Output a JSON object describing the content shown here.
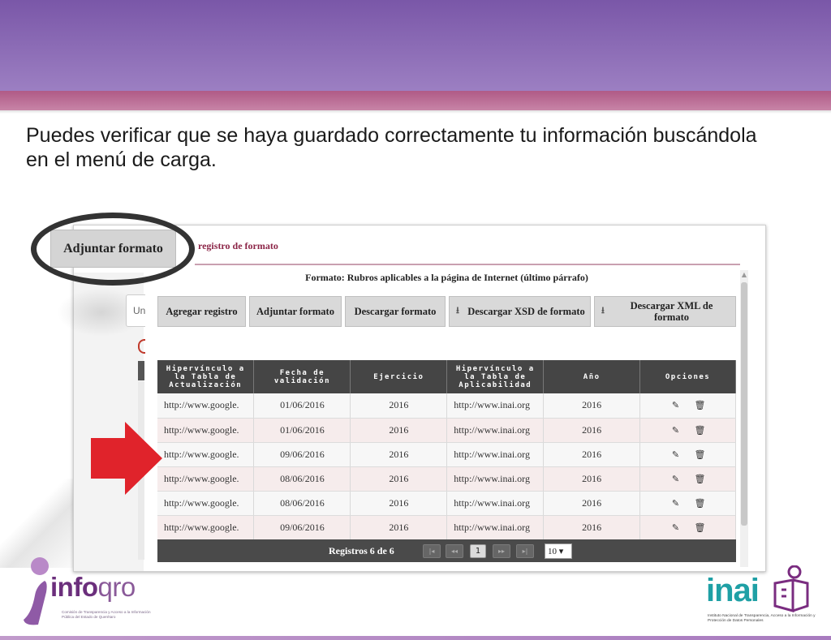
{
  "intro_text": "Puedes verificar que se haya guardado correctamente tu información buscándola en el menú de carga.",
  "modal": {
    "title": "registro de formato",
    "format_title": "Formato: Rubros aplicables a la página de Internet (último párrafo)"
  },
  "background": {
    "input_fragment": "Un"
  },
  "toolbar": {
    "agregar": "Agregar registro",
    "adjuntar": "Adjuntar formato",
    "descargar": "Descargar formato",
    "descargar_xsd": "Descargar XSD de formato",
    "descargar_xml": "Descargar XML de formato"
  },
  "callout": {
    "label": "Adjuntar formato"
  },
  "table": {
    "headers": [
      "Hipervínculo a la Tabla de Actualización",
      "Fecha de validación",
      "Ejercicio",
      "Hipervínculo a la Tabla de Aplicabilidad",
      "Año",
      "Opciones"
    ],
    "rows": [
      {
        "url1": "http://www.google.",
        "fecha": "01/06/2016",
        "ejercicio": "2016",
        "url2": "http://www.inai.org",
        "anio": "2016"
      },
      {
        "url1": "http://www.google.",
        "fecha": "01/06/2016",
        "ejercicio": "2016",
        "url2": "http://www.inai.org",
        "anio": "2016"
      },
      {
        "url1": "http://www.google.",
        "fecha": "09/06/2016",
        "ejercicio": "2016",
        "url2": "http://www.inai.org",
        "anio": "2016"
      },
      {
        "url1": "http://www.google.",
        "fecha": "08/06/2016",
        "ejercicio": "2016",
        "url2": "http://www.inai.org",
        "anio": "2016"
      },
      {
        "url1": "http://www.google.",
        "fecha": "08/06/2016",
        "ejercicio": "2016",
        "url2": "http://www.inai.org",
        "anio": "2016"
      },
      {
        "url1": "http://www.google.",
        "fecha": "09/06/2016",
        "ejercicio": "2016",
        "url2": "http://www.inai.org",
        "anio": "2016"
      }
    ]
  },
  "pager": {
    "label": "Registros 6 de 6",
    "current_page": "1",
    "page_size": "10 ▾",
    "first": "|◂",
    "prev": "◂◂",
    "next": "▸▸",
    "last": "▸|"
  },
  "logos": {
    "infoqro_word_a": "info",
    "infoqro_word_b": "qro",
    "infoqro_sub": "Comisión de Transparencia y Acceso a la Información Pública del Estado de Querétaro",
    "inai_word": "inai",
    "inai_sub": "Instituto Nacional de Transparencia, Acceso a la Información y Protección de Datos Personales"
  },
  "icons": {
    "edit": "edit-icon",
    "delete": "trash-icon",
    "download": "download-icon"
  },
  "colors": {
    "header_purple": "#7a57a8",
    "header_pink": "#b05a86",
    "table_header": "#454545",
    "arrow_red": "#e0232b",
    "inai_teal": "#1fa0a5",
    "infoqro_purple": "#6b2f7c"
  }
}
